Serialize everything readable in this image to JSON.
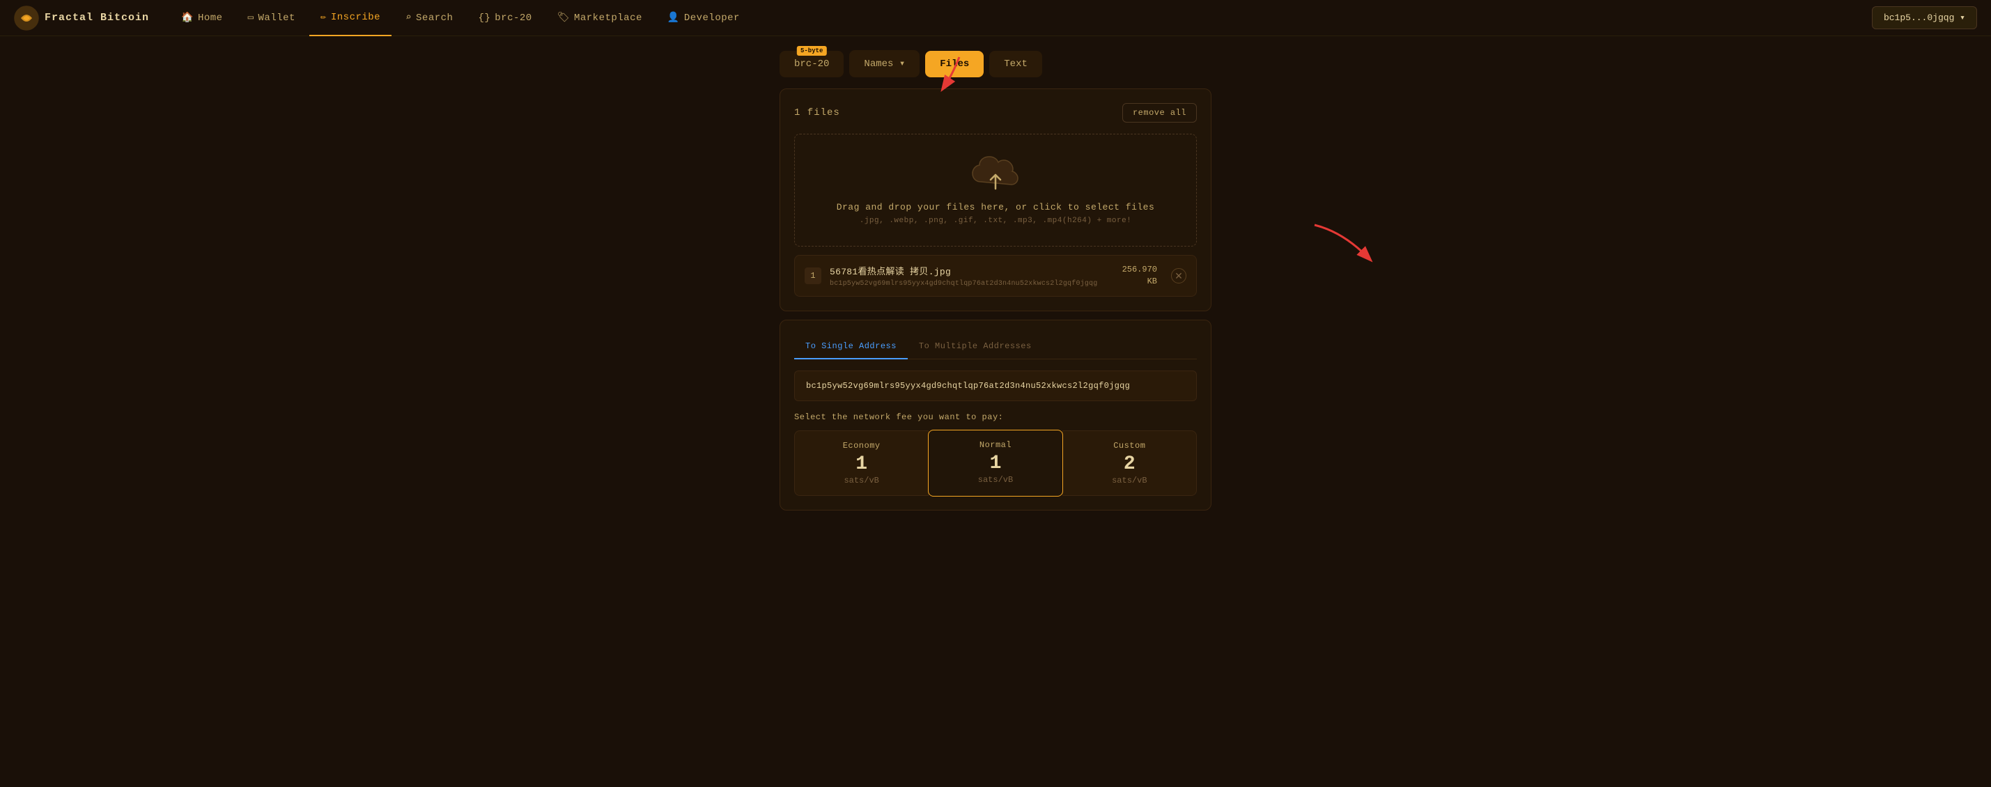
{
  "app": {
    "logo_text": "Fractal Bitcoin",
    "wallet_address": "bc1p5...0jgqg ▾"
  },
  "nav": {
    "items": [
      {
        "id": "home",
        "label": "Home",
        "icon": "🏠"
      },
      {
        "id": "wallet",
        "label": "Wallet",
        "icon": "📋"
      },
      {
        "id": "inscribe",
        "label": "Inscribe",
        "icon": "✏️",
        "active": true
      },
      {
        "id": "search",
        "label": "Search",
        "icon": "🔍"
      },
      {
        "id": "brc20",
        "label": "brc-20",
        "icon": "{}"
      },
      {
        "id": "marketplace",
        "label": "Marketplace",
        "icon": "🏷️"
      },
      {
        "id": "developer",
        "label": "Developer",
        "icon": "👤"
      }
    ]
  },
  "tabs": {
    "items": [
      {
        "id": "brc20",
        "label": "brc-20",
        "badge": "5-byte",
        "active": false
      },
      {
        "id": "names",
        "label": "Names ▾",
        "active": false
      },
      {
        "id": "files",
        "label": "Files",
        "active": true
      },
      {
        "id": "text",
        "label": "Text",
        "active": false
      }
    ]
  },
  "upload": {
    "files_count": "1 files",
    "remove_all_label": "remove all",
    "drop_text": "Drag and drop your files here, or click to select files",
    "drop_formats": ".jpg, .webp, .png, .gif, .txt, .mp3, .mp4(h264) + more!"
  },
  "file_item": {
    "number": "1",
    "name": "56781看热点解读 拷贝.jpg",
    "address": "bc1p5yw52vg69mlrs95yyx4gd9chqtlqp76at2d3n4nu52xkwcs2l2gqf0jgqg",
    "size": "256.970",
    "size_unit": "KB"
  },
  "address": {
    "tabs": [
      {
        "id": "single",
        "label": "To Single Address",
        "active": true
      },
      {
        "id": "multiple",
        "label": "To Multiple Addresses",
        "active": false
      }
    ],
    "value": "bc1p5yw52vg69mlrs95yyx4gd9chqtlqp76at2d3n4nu52xkwcs2l2gqf0jgqg"
  },
  "fee": {
    "label": "Select the network fee you want to pay:",
    "options": [
      {
        "id": "economy",
        "name": "Economy",
        "value": "1",
        "unit": "sats/vB",
        "active": false
      },
      {
        "id": "normal",
        "name": "Normal",
        "value": "1",
        "unit": "sats/vB",
        "active": true
      },
      {
        "id": "custom",
        "name": "Custom",
        "value": "2",
        "unit": "sats/vB",
        "active": false
      }
    ]
  }
}
